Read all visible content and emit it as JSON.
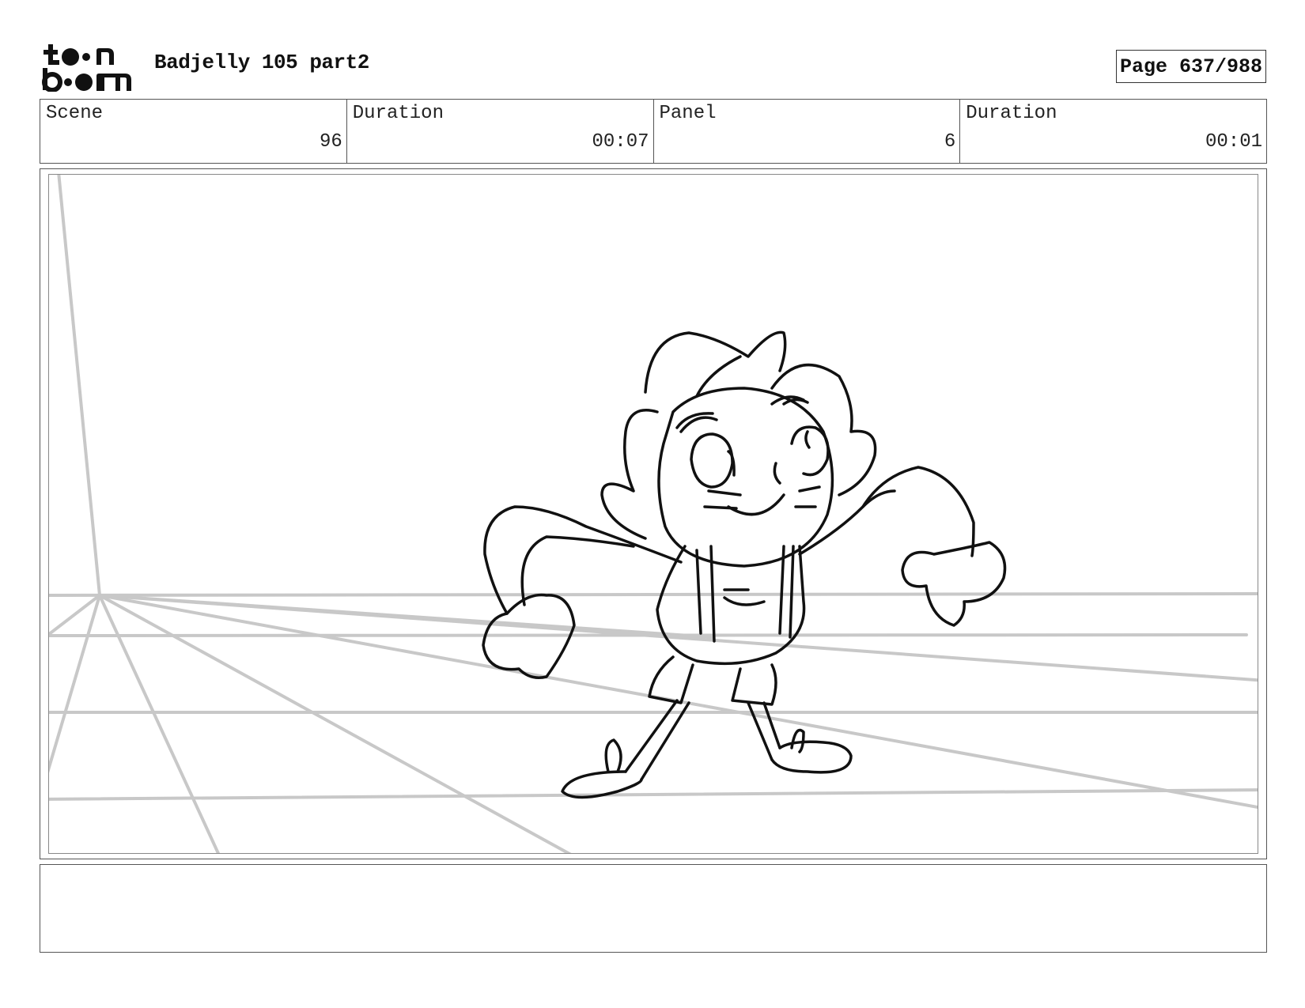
{
  "header": {
    "logo_text_line1": "toon",
    "logo_text_line2": "boom",
    "title": "Badjelly 105 part2",
    "page_label": "Page 637/988"
  },
  "info": {
    "scene_label": "Scene",
    "scene_value": "96",
    "duration_label": "Duration",
    "duration_value": "00:07",
    "panel_label": "Panel",
    "panel_value": "6",
    "panel_duration_label": "Duration",
    "panel_duration_value": "00:01"
  },
  "panel": {
    "description": "",
    "line_color": "#111111",
    "guide_color": "#c8c8c8"
  },
  "notes": {
    "text": ""
  }
}
